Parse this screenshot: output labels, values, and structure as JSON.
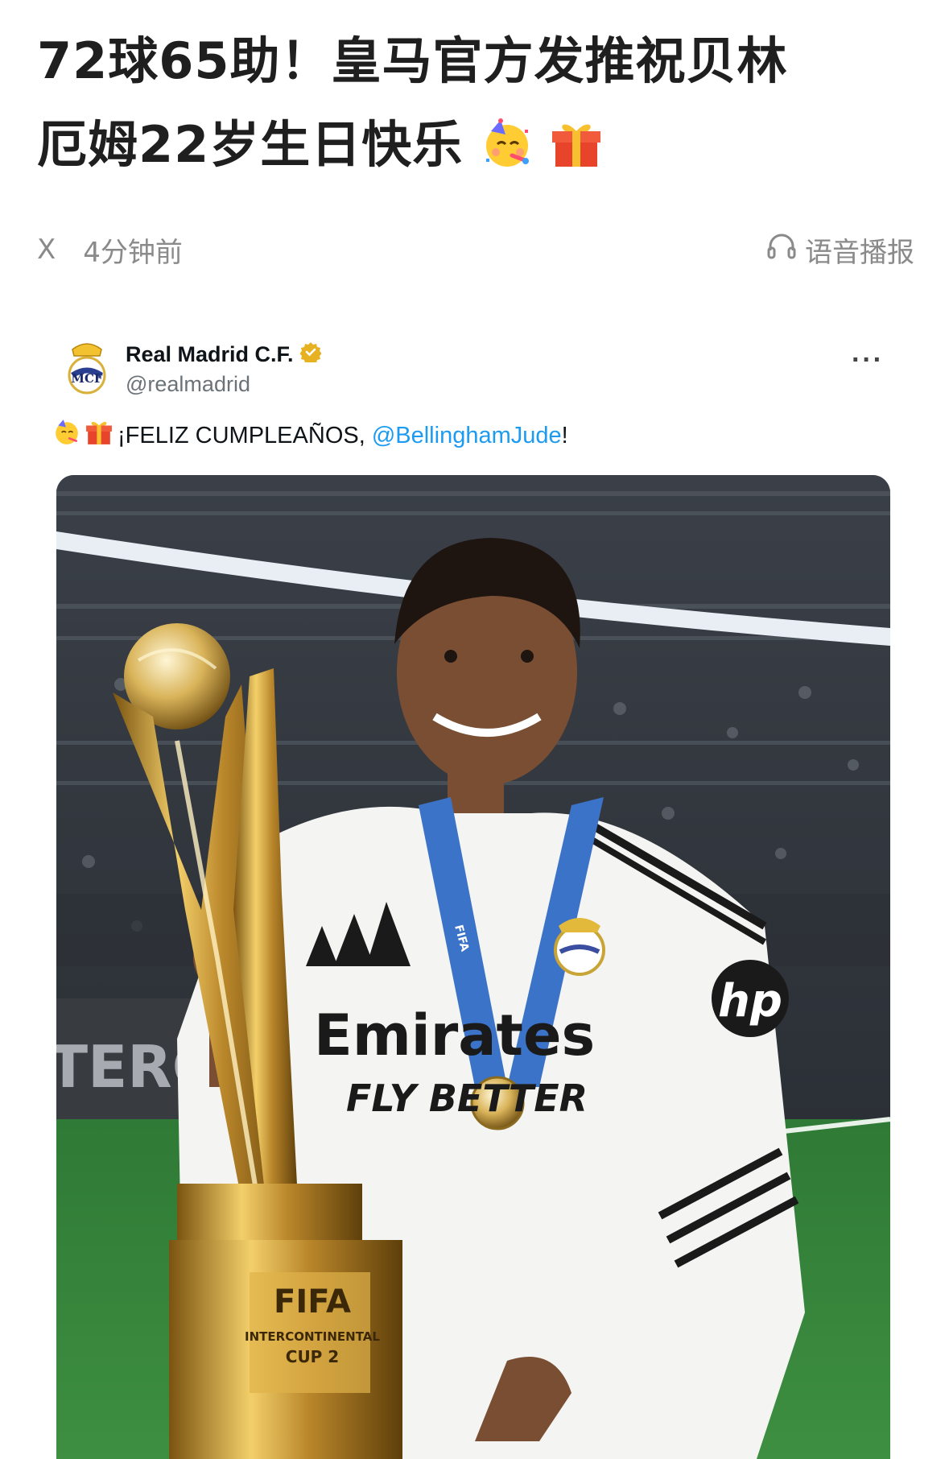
{
  "article": {
    "headline_line1": "72球65助！皇马官方发推祝贝林",
    "headline_line2": "厄姆22岁生日快乐",
    "headline_emojis": [
      "partying-face-emoji",
      "wrapped-gift-emoji"
    ]
  },
  "meta": {
    "source": "X",
    "time_ago": "4分钟前",
    "audio_label": "语音播报",
    "audio_icon": "headphones-icon"
  },
  "tweet": {
    "display_name": "Real Madrid C.F.",
    "verified_icon": "verified-badge-icon",
    "handle": "@realmadrid",
    "more_label": "···",
    "text_prefix": "¡FELIZ CUMPLEAÑOS, ",
    "mention": "@BellinghamJude",
    "text_suffix": "!",
    "photo": {
      "shirt_text_1": "Emirates",
      "shirt_text_2": "FLY BETTER",
      "sleeve_logo": "hp",
      "trophy_text_1": "FIFA",
      "trophy_text_2": "INTERCONTINENTAL",
      "trophy_text_3": "CUP 2",
      "board_text": "TERCO",
      "medal_ribbon_text": "FIFA"
    }
  },
  "colors": {
    "mention": "#1d9bf0",
    "meta_gray": "#8a8a8a",
    "verified_gold": "#e6b222"
  }
}
